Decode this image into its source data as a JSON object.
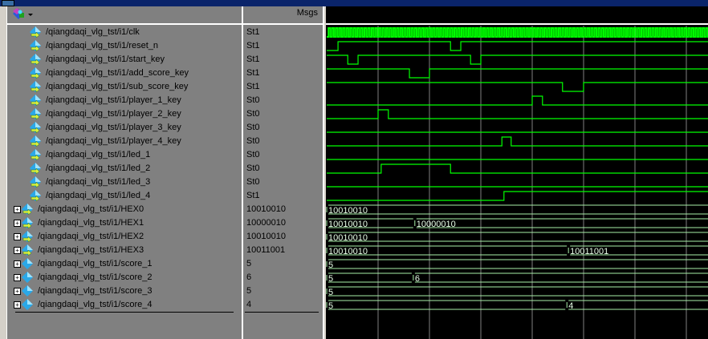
{
  "header": {
    "msgs_label": "Msgs"
  },
  "colors": {
    "wave": "#00ff00",
    "bus": "#a8f0a8",
    "grid": "#808080",
    "icon": "#2aa8e8"
  },
  "timebase": {
    "grid_step": 100,
    "clock_half_period": 3.5,
    "end": 740
  },
  "signals": [
    {
      "name": "/qiangdaqi_vlg_tst/i1/clk",
      "value": "St1",
      "type": "clock"
    },
    {
      "name": "/qiangdaqi_vlg_tst/i1/reset_n",
      "value": "St1",
      "type": "bit",
      "init": 0,
      "edges": [
        22,
        241,
        261
      ]
    },
    {
      "name": "/qiangdaqi_vlg_tst/i1/start_key",
      "value": "St1",
      "type": "bit",
      "init": 1,
      "edges": [
        41,
        61,
        280,
        300
      ]
    },
    {
      "name": "/qiangdaqi_vlg_tst/i1/add_score_key",
      "value": "St1",
      "type": "bit",
      "init": 1,
      "edges": [
        161,
        200
      ]
    },
    {
      "name": "/qiangdaqi_vlg_tst/i1/sub_score_key",
      "value": "St1",
      "type": "bit",
      "init": 1,
      "edges": [
        459,
        500
      ]
    },
    {
      "name": "/qiangdaqi_vlg_tst/i1/player_1_key",
      "value": "St0",
      "type": "bit",
      "init": 0,
      "edges": [
        400,
        420
      ]
    },
    {
      "name": "/qiangdaqi_vlg_tst/i1/player_2_key",
      "value": "St0",
      "type": "bit",
      "init": 0,
      "edges": [
        100,
        120
      ]
    },
    {
      "name": "/qiangdaqi_vlg_tst/i1/player_3_key",
      "value": "St0",
      "type": "bit",
      "init": 0,
      "edges": []
    },
    {
      "name": "/qiangdaqi_vlg_tst/i1/player_4_key",
      "value": "St0",
      "type": "bit",
      "init": 0,
      "edges": [
        341,
        359
      ]
    },
    {
      "name": "/qiangdaqi_vlg_tst/i1/led_1",
      "value": "St0",
      "type": "bit",
      "init": 0,
      "edges": [],
      "out": true
    },
    {
      "name": "/qiangdaqi_vlg_tst/i1/led_2",
      "value": "St0",
      "type": "bit",
      "init": 0,
      "edges": [
        106,
        241
      ],
      "out": true
    },
    {
      "name": "/qiangdaqi_vlg_tst/i1/led_3",
      "value": "St0",
      "type": "bit",
      "init": 0,
      "edges": [],
      "out": true
    },
    {
      "name": "/qiangdaqi_vlg_tst/i1/led_4",
      "value": "St1",
      "type": "bit",
      "init": 0,
      "edges": [
        345
      ],
      "out": true
    },
    {
      "name": "/qiangdaqi_vlg_tst/i1/HEX0",
      "value": "10010010",
      "type": "bus",
      "out": true,
      "segments": [
        {
          "t": 0,
          "v": "10010010"
        }
      ]
    },
    {
      "name": "/qiangdaqi_vlg_tst/i1/HEX1",
      "value": "10000010",
      "type": "bus",
      "out": true,
      "segments": [
        {
          "t": 0,
          "v": "10010010"
        },
        {
          "t": 170,
          "v": "10000010"
        }
      ]
    },
    {
      "name": "/qiangdaqi_vlg_tst/i1/HEX2",
      "value": "10010010",
      "type": "bus",
      "out": true,
      "segments": [
        {
          "t": 0,
          "v": "10010010"
        }
      ]
    },
    {
      "name": "/qiangdaqi_vlg_tst/i1/HEX3",
      "value": "10011001",
      "type": "bus",
      "out": true,
      "segments": [
        {
          "t": 0,
          "v": "10010010"
        },
        {
          "t": 469,
          "v": "10011001"
        }
      ]
    },
    {
      "name": "/qiangdaqi_vlg_tst/i1/score_1",
      "value": "5",
      "type": "bus",
      "segments": [
        {
          "t": 0,
          "v": "5"
        }
      ]
    },
    {
      "name": "/qiangdaqi_vlg_tst/i1/score_2",
      "value": "6",
      "type": "bus",
      "segments": [
        {
          "t": 0,
          "v": "5"
        },
        {
          "t": 167,
          "v": "6"
        }
      ]
    },
    {
      "name": "/qiangdaqi_vlg_tst/i1/score_3",
      "value": "5",
      "type": "bus",
      "segments": [
        {
          "t": 0,
          "v": "5"
        }
      ]
    },
    {
      "name": "/qiangdaqi_vlg_tst/i1/score_4",
      "value": "4",
      "type": "bus",
      "segments": [
        {
          "t": 0,
          "v": "5"
        },
        {
          "t": 466,
          "v": "4"
        }
      ]
    }
  ]
}
